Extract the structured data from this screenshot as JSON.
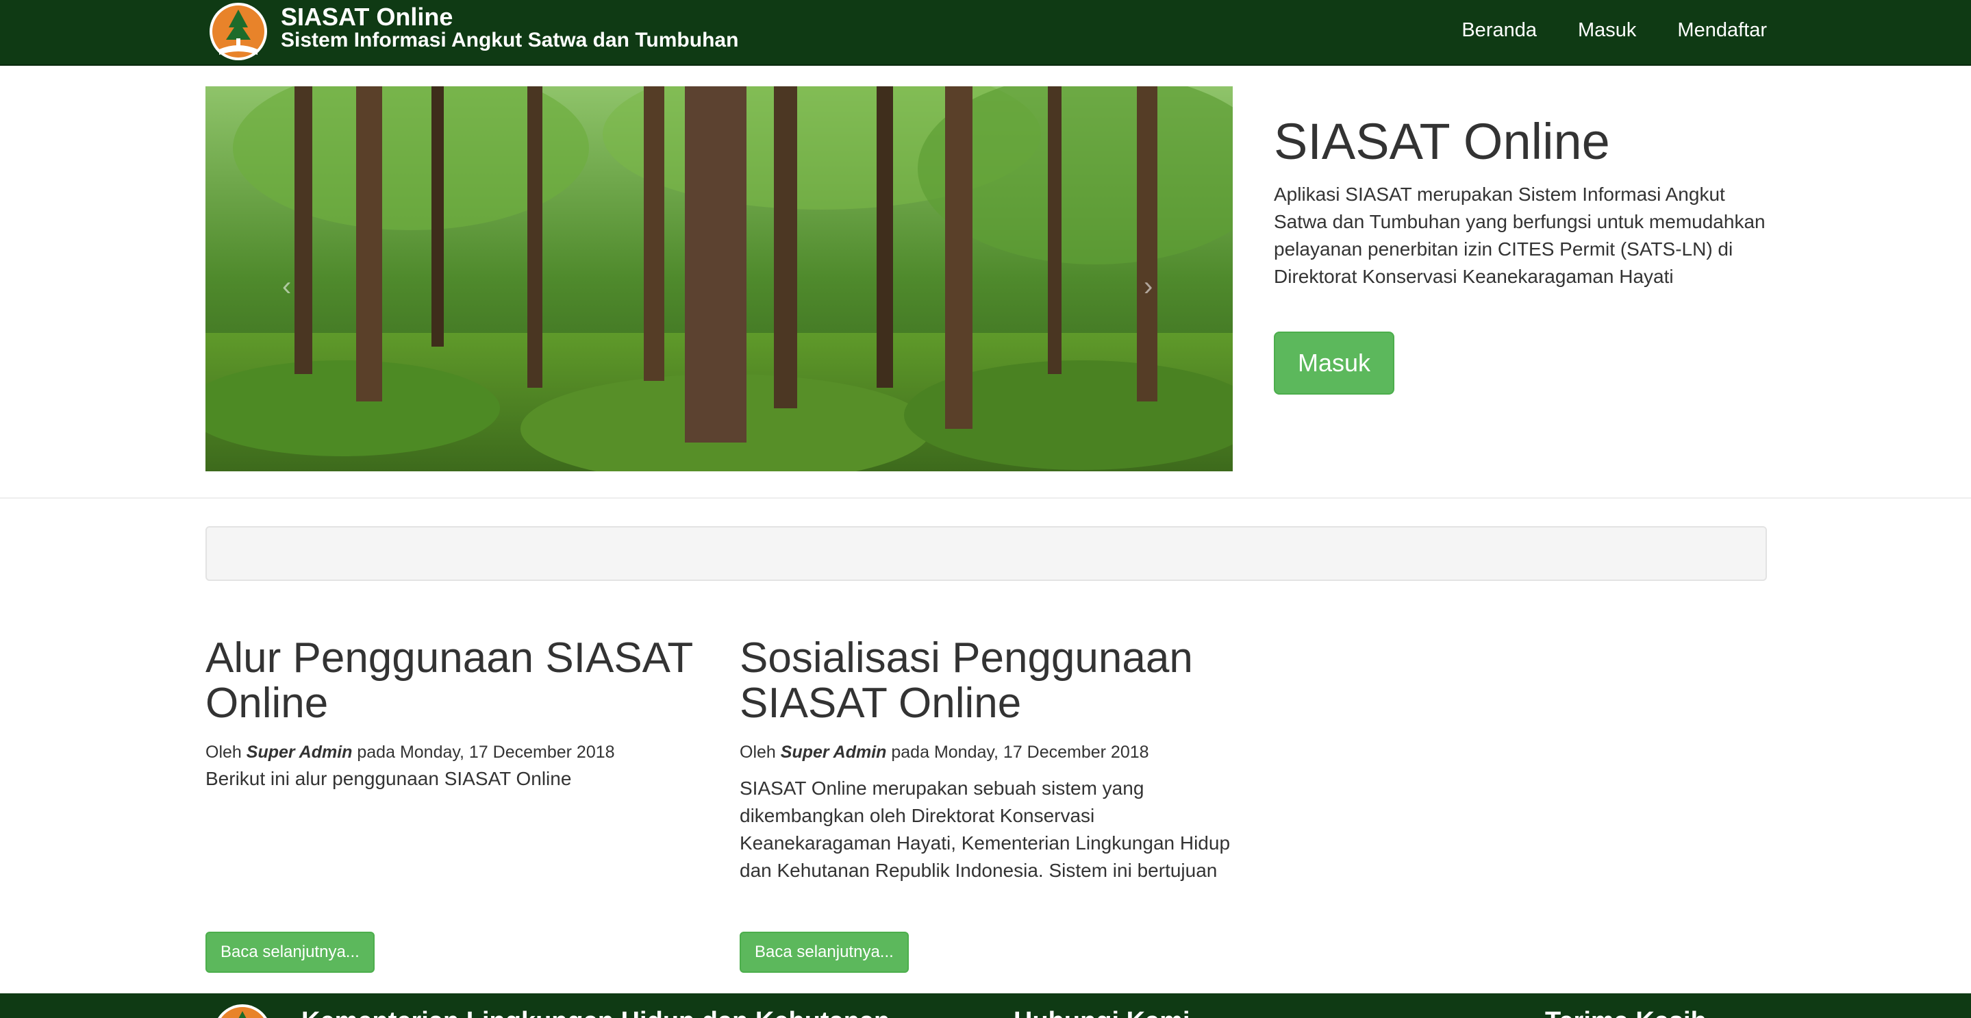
{
  "navbar": {
    "title": "SIASAT Online",
    "subtitle": "Sistem Informasi Angkut Satwa dan Tumbuhan",
    "links": [
      "Beranda",
      "Masuk",
      "Mendaftar"
    ]
  },
  "carousel": {
    "prev_icon": "chevron-left",
    "next_icon": "chevron-right"
  },
  "hero": {
    "title": "SIASAT Online",
    "description": "Aplikasi SIASAT merupakan Sistem Informasi Angkut Satwa dan Tumbuhan yang berfungsi untuk memudahkan pelayanan penerbitan izin CITES Permit (SATS-LN) di Direktorat Konservasi Keanekaragaman Hayati",
    "button": "Masuk"
  },
  "articles": [
    {
      "title": "Alur Penggunaan SIASAT Online",
      "meta_prefix": "Oleh",
      "author": "Super Admin",
      "meta_mid": "pada",
      "date": "Monday, 17 December 2018",
      "summary": "Berikut ini alur penggunaan SIASAT Online",
      "button": "Baca selanjutnya..."
    },
    {
      "title": "Sosialisasi Penggunaan SIASAT Online",
      "meta_prefix": "Oleh",
      "author": "Super Admin",
      "meta_mid": "pada",
      "date": "Monday, 17 December 2018",
      "summary": "SIASAT Online merupakan sebuah sistem yang dikembangkan oleh Direktorat Konservasi Keanekaragaman Hayati, Kementerian Lingkungan Hidup dan Kehutanan Republik Indonesia. Sistem ini bertujuan untuk meningkatkan pelayanan penerbitan izin SATS-LN",
      "button": "Baca selanjutnya..."
    }
  ],
  "footer": {
    "ministry": "Kementerian Lingkungan Hidup dan Kehutanan",
    "contact": "Hubungi Kami",
    "thanks": "Terima Kasih"
  },
  "colors": {
    "navbar": "#0f3a14",
    "button": "#5cb85c",
    "text": "#333333"
  }
}
